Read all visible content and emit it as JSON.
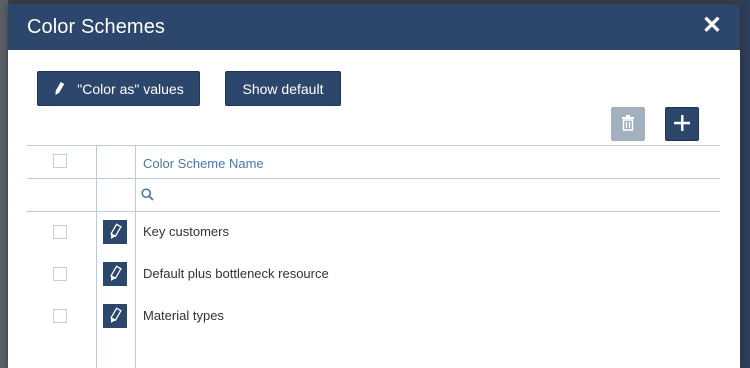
{
  "dialog": {
    "title": "Color Schemes",
    "close_glyph": "✕"
  },
  "toolbar": {
    "color_as_label": "\"Color as\" values",
    "show_default_label": "Show default",
    "delete_icon": "trash-icon",
    "add_icon": "plus-icon"
  },
  "table": {
    "column_header": "Color Scheme Name",
    "search_placeholder": "",
    "rows": [
      {
        "name": "Key customers"
      },
      {
        "name": "Default plus bottleneck resource"
      },
      {
        "name": "Material types"
      }
    ]
  },
  "colors": {
    "primary": "#2c466c",
    "disabled_button": "#a3b0c0",
    "header_text": "#4a77a8",
    "grid_line": "#b9cbe0"
  }
}
